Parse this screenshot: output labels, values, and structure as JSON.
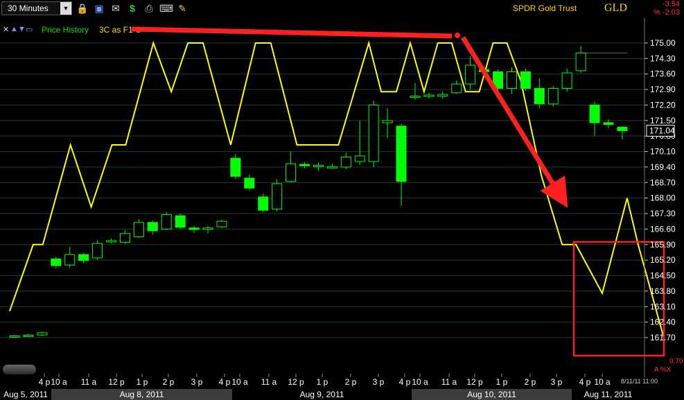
{
  "toolbar": {
    "interval": "30 Minutes",
    "icons": [
      "lock-icon",
      "save-icon",
      "mail-icon",
      "dollar-icon",
      "print-icon",
      "keyboard-icon",
      "pencil-icon"
    ]
  },
  "header": {
    "security_name": "SPDR Gold Trust",
    "symbol": "GLD",
    "change_abs": "-3.54",
    "change_pct": "% -2.03"
  },
  "legend": {
    "price_label": "Price History",
    "indicator_label": "3C as F1 C"
  },
  "footer": {
    "date_time": "8/11/11 11:00",
    "small_value": "0.70",
    "small_icons": "A %X"
  },
  "colors": {
    "up": "#00ff00",
    "down": "#00ff00",
    "indicator": "#ffff00",
    "annotation": "#ff2020",
    "price_tag_border": "#ffffff"
  },
  "chart_data": {
    "type": "candlestick",
    "title": "SPDR Gold Trust (GLD) 30 Minutes",
    "y_axis": {
      "ticks": [
        "175.00",
        "174.30",
        "173.60",
        "172.90",
        "172.20",
        "171.50",
        "170.80",
        "170.10",
        "169.40",
        "168.70",
        "168.00",
        "167.30",
        "166.60",
        "165.90",
        "165.20",
        "164.50",
        "163.80",
        "163.10",
        "162.40",
        "161.70"
      ],
      "ylim": [
        161.2,
        175.3
      ]
    },
    "last_price": "171.04",
    "x_ticks": [
      "4 p",
      "10 a",
      "11 a",
      "12 p",
      "1 p",
      "2 p",
      "3 p",
      "4 p",
      "10 a",
      "11 a",
      "12 p",
      "1 p",
      "2 p",
      "3 p",
      "4 p",
      "10 a",
      "11 a",
      "12 p",
      "1 p",
      "2 p",
      "3 p",
      "4 p",
      "10 a"
    ],
    "date_segments": [
      {
        "label": "Aug 5, 2011",
        "shade": false
      },
      {
        "label": "Aug 8, 2011",
        "shade": true
      },
      {
        "label": "Aug 9, 2011",
        "shade": false
      },
      {
        "label": "Aug 10, 2011",
        "shade": true
      },
      {
        "label": "Aug 11, 2011",
        "shade": false
      }
    ],
    "candles": [
      {
        "o": 161.78,
        "c": 161.78,
        "h": 161.83,
        "l": 161.72
      },
      {
        "o": 161.81,
        "c": 161.81,
        "h": 161.86,
        "l": 161.75
      },
      {
        "o": 161.82,
        "c": 161.92,
        "h": 161.97,
        "l": 161.77
      },
      {
        "o": 165.25,
        "c": 164.95,
        "h": 165.35,
        "l": 164.82
      },
      {
        "o": 164.98,
        "c": 165.45,
        "h": 165.8,
        "l": 164.85
      },
      {
        "o": 165.45,
        "c": 165.18,
        "h": 165.52,
        "l": 165.05
      },
      {
        "o": 165.3,
        "c": 165.95,
        "h": 166.1,
        "l": 165.2
      },
      {
        "o": 166.05,
        "c": 166.08,
        "h": 166.18,
        "l": 165.97
      },
      {
        "o": 166.0,
        "c": 166.4,
        "h": 166.55,
        "l": 165.93
      },
      {
        "o": 166.25,
        "c": 166.9,
        "h": 167.05,
        "l": 166.2
      },
      {
        "o": 166.9,
        "c": 166.52,
        "h": 167.0,
        "l": 166.35
      },
      {
        "o": 166.6,
        "c": 167.25,
        "h": 167.35,
        "l": 166.55
      },
      {
        "o": 167.2,
        "c": 166.68,
        "h": 167.3,
        "l": 166.6
      },
      {
        "o": 166.65,
        "c": 166.58,
        "h": 166.75,
        "l": 166.42
      },
      {
        "o": 166.62,
        "c": 166.65,
        "h": 166.75,
        "l": 166.4
      },
      {
        "o": 166.7,
        "c": 166.95,
        "h": 167.02,
        "l": 166.65
      },
      {
        "o": 169.8,
        "c": 168.98,
        "h": 170.0,
        "l": 168.85
      },
      {
        "o": 168.9,
        "c": 168.45,
        "h": 169.05,
        "l": 168.35
      },
      {
        "o": 168.05,
        "c": 167.45,
        "h": 168.2,
        "l": 167.35
      },
      {
        "o": 167.5,
        "c": 168.65,
        "h": 168.85,
        "l": 167.4
      },
      {
        "o": 168.75,
        "c": 169.55,
        "h": 170.1,
        "l": 168.7
      },
      {
        "o": 169.52,
        "c": 169.48,
        "h": 169.62,
        "l": 169.35
      },
      {
        "o": 169.45,
        "c": 169.48,
        "h": 169.62,
        "l": 169.22
      },
      {
        "o": 169.4,
        "c": 169.42,
        "h": 169.55,
        "l": 169.33
      },
      {
        "o": 169.4,
        "c": 169.85,
        "h": 170.05,
        "l": 169.3
      },
      {
        "o": 169.65,
        "c": 169.9,
        "h": 171.5,
        "l": 169.5
      },
      {
        "o": 169.65,
        "c": 172.2,
        "h": 172.4,
        "l": 169.4
      },
      {
        "o": 171.4,
        "c": 171.5,
        "h": 172.05,
        "l": 170.7
      },
      {
        "o": 171.25,
        "c": 168.75,
        "h": 171.35,
        "l": 167.65
      },
      {
        "o": 172.55,
        "c": 172.6,
        "h": 173.2,
        "l": 172.45
      },
      {
        "o": 172.6,
        "c": 172.65,
        "h": 172.75,
        "l": 172.5
      },
      {
        "o": 172.6,
        "c": 172.68,
        "h": 172.8,
        "l": 172.5
      },
      {
        "o": 172.75,
        "c": 173.15,
        "h": 173.3,
        "l": 172.7
      },
      {
        "o": 173.15,
        "c": 174.0,
        "h": 174.4,
        "l": 172.9
      },
      {
        "o": 173.8,
        "c": 173.7,
        "h": 173.95,
        "l": 173.5
      },
      {
        "o": 173.7,
        "c": 172.95,
        "h": 173.8,
        "l": 172.8
      },
      {
        "o": 172.95,
        "c": 173.7,
        "h": 173.9,
        "l": 172.7
      },
      {
        "o": 173.7,
        "c": 172.95,
        "h": 173.85,
        "l": 172.85
      },
      {
        "o": 172.95,
        "c": 172.25,
        "h": 173.4,
        "l": 172.05
      },
      {
        "o": 172.25,
        "c": 172.95,
        "h": 173.05,
        "l": 172.15
      },
      {
        "o": 172.95,
        "c": 173.65,
        "h": 173.85,
        "l": 172.8
      },
      {
        "o": 173.75,
        "c": 174.55,
        "h": 174.88,
        "l": 173.65
      },
      {
        "o": 172.2,
        "c": 171.4,
        "h": 172.35,
        "l": 170.8
      },
      {
        "o": 171.4,
        "c": 171.32,
        "h": 171.55,
        "l": 171.15
      },
      {
        "o": 171.2,
        "c": 171.04,
        "h": 171.25,
        "l": 170.65
      }
    ],
    "indicator": {
      "name": "3C",
      "points": [
        [
          0.0,
          162.9
        ],
        [
          1.7,
          165.9
        ],
        [
          2.4,
          165.9
        ],
        [
          4.4,
          170.4
        ],
        [
          5.9,
          167.6
        ],
        [
          7.4,
          170.4
        ],
        [
          8.4,
          170.4
        ],
        [
          10.4,
          175.0
        ],
        [
          11.7,
          172.8
        ],
        [
          12.9,
          175.0
        ],
        [
          14.0,
          175.0
        ],
        [
          16.0,
          170.4
        ],
        [
          17.8,
          175.0
        ],
        [
          18.9,
          175.0
        ],
        [
          20.8,
          170.4
        ],
        [
          23.8,
          170.4
        ],
        [
          26.0,
          175.0
        ],
        [
          26.9,
          172.8
        ],
        [
          28.0,
          172.8
        ],
        [
          29.0,
          175.0
        ],
        [
          30.0,
          172.8
        ],
        [
          31.0,
          175.0
        ],
        [
          32.0,
          175.0
        ],
        [
          33.0,
          172.8
        ],
        [
          34.0,
          172.8
        ],
        [
          35.0,
          175.0
        ],
        [
          36.0,
          175.0
        ],
        [
          37.0,
          173.3
        ],
        [
          38.5,
          169.0
        ],
        [
          40.0,
          165.9
        ],
        [
          41.0,
          165.9
        ],
        [
          42.9,
          163.7
        ],
        [
          44.7,
          168.0
        ],
        [
          45.5,
          165.9
        ],
        [
          47.4,
          161.6
        ]
      ]
    },
    "reference_line": 174.55
  }
}
